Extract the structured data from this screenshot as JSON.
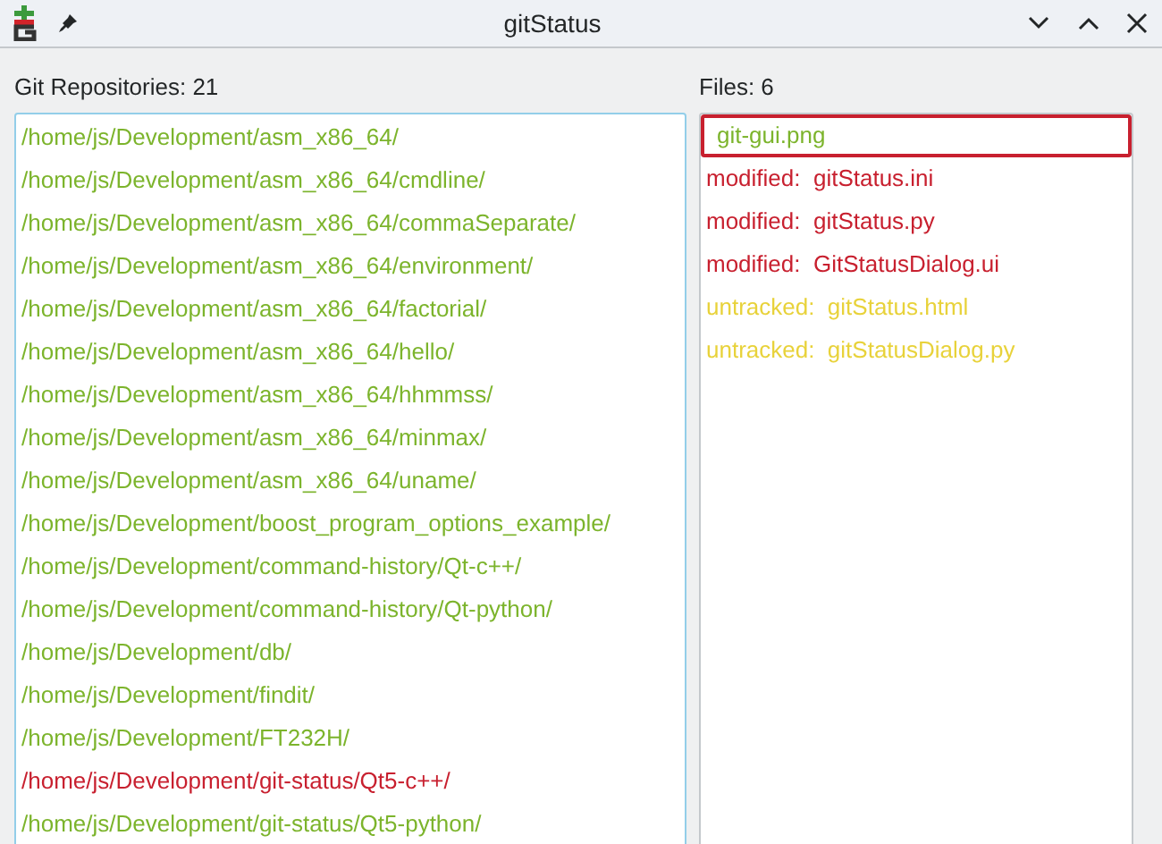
{
  "window": {
    "title": "gitStatus"
  },
  "repositories": {
    "label": "Git Repositories: 21",
    "items": [
      {
        "path": "/home/js/Development/asm_x86_64/",
        "color": "#7cb42c"
      },
      {
        "path": "/home/js/Development/asm_x86_64/cmdline/",
        "color": "#7cb42c"
      },
      {
        "path": "/home/js/Development/asm_x86_64/commaSeparate/",
        "color": "#7cb42c"
      },
      {
        "path": "/home/js/Development/asm_x86_64/environment/",
        "color": "#7cb42c"
      },
      {
        "path": "/home/js/Development/asm_x86_64/factorial/",
        "color": "#7cb42c"
      },
      {
        "path": "/home/js/Development/asm_x86_64/hello/",
        "color": "#7cb42c"
      },
      {
        "path": "/home/js/Development/asm_x86_64/hhmmss/",
        "color": "#7cb42c"
      },
      {
        "path": "/home/js/Development/asm_x86_64/minmax/",
        "color": "#7cb42c"
      },
      {
        "path": "/home/js/Development/asm_x86_64/uname/",
        "color": "#7cb42c"
      },
      {
        "path": "/home/js/Development/boost_program_options_example/",
        "color": "#7cb42c"
      },
      {
        "path": "/home/js/Development/command-history/Qt-c++/",
        "color": "#7cb42c"
      },
      {
        "path": "/home/js/Development/command-history/Qt-python/",
        "color": "#7cb42c"
      },
      {
        "path": "/home/js/Development/db/",
        "color": "#7cb42c"
      },
      {
        "path": "/home/js/Development/findit/",
        "color": "#7cb42c"
      },
      {
        "path": "/home/js/Development/FT232H/",
        "color": "#7cb42c"
      },
      {
        "path": "/home/js/Development/git-status/Qt5-c++/",
        "color": "#c8202f"
      },
      {
        "path": "/home/js/Development/git-status/Qt5-python/",
        "color": "#7cb42c"
      }
    ]
  },
  "files": {
    "label": "Files: 6",
    "items": [
      {
        "text": "git-gui.png",
        "color": "#7cb42c",
        "selected": true
      },
      {
        "text": "modified:  gitStatus.ini",
        "color": "#c8202f",
        "selected": false
      },
      {
        "text": "modified:  gitStatus.py",
        "color": "#c8202f",
        "selected": false
      },
      {
        "text": "modified:  GitStatusDialog.ui",
        "color": "#c8202f",
        "selected": false
      },
      {
        "text": "untracked:  gitStatus.html",
        "color": "#e8d23a",
        "selected": false
      },
      {
        "text": "untracked:  gitStatusDialog.py",
        "color": "#e8d23a",
        "selected": false
      }
    ]
  }
}
